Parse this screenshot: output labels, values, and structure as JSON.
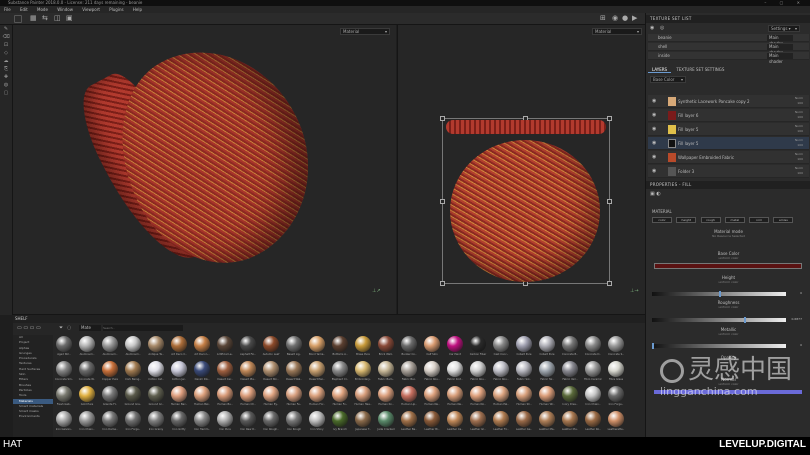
{
  "window": {
    "title": "Substance Painter 2018.0.0 - License: 211 days remaining - beanie"
  },
  "menu": [
    "File",
    "Edit",
    "Mode",
    "Window",
    "Viewport",
    "Plugins",
    "Help"
  ],
  "viewport": {
    "view3d_mode": "Material",
    "view2d_mode": "Material"
  },
  "texture_set_list": {
    "title": "TEXTURE SET LIST",
    "settings_label": "Settings ▾",
    "rows": [
      {
        "name": "beanie",
        "shader": "Main shader"
      },
      {
        "name": "shell",
        "shader": "Main shader"
      },
      {
        "name": "inside",
        "shader": "Main shader"
      }
    ]
  },
  "layers_panel": {
    "tabs": [
      "LAYERS",
      "TEXTURE SET SETTINGS"
    ],
    "blend_dropdown": "Base Color",
    "rows": [
      {
        "name": "Synthetic Lacework Pancake copy 2",
        "thumb": "#d7a978",
        "selected": false,
        "blend": "Norm",
        "opacity": "100"
      },
      {
        "name": "Fill layer 6",
        "thumb": "#7a1b1b",
        "selected": false,
        "blend": "Norm",
        "opacity": "100"
      },
      {
        "name": "Fill layer 5",
        "thumb": "#e0c04a",
        "selected": false,
        "blend": "Norm",
        "opacity": "100"
      },
      {
        "name": "Fill layer 5",
        "thumb": "#111111",
        "selected": true,
        "blend": "Norm",
        "opacity": "100"
      },
      {
        "name": "Wallpaper Embroided Fabric",
        "thumb": "#b84a2a",
        "selected": false,
        "blend": "Norm",
        "opacity": "100"
      },
      {
        "name": "Folder 3",
        "thumb": "#555555",
        "selected": false,
        "blend": "Norm",
        "opacity": "100"
      }
    ]
  },
  "properties": {
    "title": "PROPERTIES - FILL",
    "section": "MATERIAL",
    "channels": [
      "color",
      "height",
      "rough",
      "metal",
      "nrm",
      "emiss"
    ],
    "material_mode": {
      "label": "Material mode",
      "value": "No Resource Selected"
    },
    "base_color": {
      "label": "Base Color",
      "sub": "uniform color",
      "swatch": "#5a1212"
    },
    "height": {
      "label": "Height",
      "sub": "uniform color",
      "value": "0",
      "fill": 0.5
    },
    "roughness": {
      "label": "Roughness",
      "sub": "uniform color",
      "value": "0.6877",
      "fill": 0.69
    },
    "metallic": {
      "label": "Metallic",
      "sub": "uniform color",
      "value": "0",
      "fill": 0.0
    },
    "opacity_label": "Opacity",
    "normal_label": "Normal",
    "normal_sub": "uniform color"
  },
  "shelf": {
    "title": "SHELF",
    "search_placeholder": "Search...",
    "filter_label": "Mate",
    "categories": [
      "All",
      "Project",
      "Alphas",
      "Grunges",
      "Procedurals",
      "Textures",
      "Hard Surfaces",
      "Skin",
      "Filters",
      "Brushes",
      "Particles",
      "Tools",
      "Materials",
      "Smart materials",
      "Smart masks",
      "Environments"
    ],
    "active_category": "Materials",
    "materials": [
      {
        "n": "Aged Stri..",
        "c": "#6b6b6b"
      },
      {
        "n": "Aluminum..",
        "c": "#b5b5b5"
      },
      {
        "n": "Aluminum..",
        "c": "#9a9a9a"
      },
      {
        "n": "Aluminum..",
        "c": "#c8c8c8"
      },
      {
        "n": "Antique Ta..",
        "c": "#a88a6a"
      },
      {
        "n": "Art Deco C..",
        "c": "#ad6e3a"
      },
      {
        "n": "Art Deco L..",
        "c": "#c57f46"
      },
      {
        "n": "Artificial Le..",
        "c": "#5a4638"
      },
      {
        "n": "Asphalt Fin..",
        "c": "#4a4a4a"
      },
      {
        "n": "Autumn Leaf",
        "c": "#8c4a2a"
      },
      {
        "n": "Basalt Lig..",
        "c": "#707070"
      },
      {
        "n": "Bond Yama..",
        "c": "#d8a068"
      },
      {
        "n": "Bottoms A..",
        "c": "#5c4030"
      },
      {
        "n": "Brass Pure",
        "c": "#c89a3a"
      },
      {
        "n": "Brick Wall..",
        "c": "#8a4a38"
      },
      {
        "n": "Bunker Co..",
        "c": "#6a6a6a"
      },
      {
        "n": "Calf Skin",
        "c": "#d89a70"
      },
      {
        "n": "Car Paint",
        "c": "#c01080"
      },
      {
        "n": "Carbon Fiber",
        "c": "#2a2a2a"
      },
      {
        "n": "Cast Conc..",
        "c": "#888888"
      },
      {
        "n": "Cobalt Pure",
        "c": "#a0a0b0"
      },
      {
        "n": "Cobalt Pure",
        "c": "#b0b0b8"
      },
      {
        "n": "Concrete B..",
        "c": "#777777"
      },
      {
        "n": "Concrete D..",
        "c": "#8a8a8a"
      },
      {
        "n": "Concrete S..",
        "c": "#9a9a9a"
      },
      {
        "n": "Concrete Sm..",
        "c": "#858585"
      },
      {
        "n": "Concrete W..",
        "c": "#6a6a6a"
      },
      {
        "n": "Copper Pure",
        "c": "#c8703a"
      },
      {
        "n": "Cork Being..",
        "c": "#a07a50"
      },
      {
        "n": "Cotton Cat..",
        "c": "#e0e0e8"
      },
      {
        "n": "Cotton Jer..",
        "c": "#c8c8d8"
      },
      {
        "n": "Denim Riv..",
        "c": "#3a4a78"
      },
      {
        "n": "Desert Cer..",
        "c": "#a06040"
      },
      {
        "n": "Desert Pla..",
        "c": "#c08858"
      },
      {
        "n": "Desert Stn..",
        "c": "#b09070"
      },
      {
        "n": "Desert Wal..",
        "c": "#9a7858"
      },
      {
        "n": "Desert Pan..",
        "c": "#c8a070"
      },
      {
        "n": "Elephant Cr..",
        "c": "#8a8a8a"
      },
      {
        "n": "Embroidery..",
        "c": "#d8b870"
      },
      {
        "n": "Fabric Bam..",
        "c": "#c8b898"
      },
      {
        "n": "Fabric Bar..",
        "c": "#a8a098"
      },
      {
        "n": "Fabric Rou..",
        "c": "#d8d0c8"
      },
      {
        "n": "Fabric Knit..",
        "c": "#e0e0e0"
      },
      {
        "n": "Fabric Rou..",
        "c": "#d0d0d0"
      },
      {
        "n": "Fabric Rou..",
        "c": "#c0c0c8"
      },
      {
        "n": "Fabric Sol..",
        "c": "#b8b8c0"
      },
      {
        "n": "Fabric Tw..",
        "c": "#a0a8b0"
      },
      {
        "n": "Fabric Vari..",
        "c": "#888890"
      },
      {
        "n": "Fibro Ceramic",
        "c": "#9a9a9a"
      },
      {
        "n": "Fibre Glass",
        "c": "#d8d8d0"
      },
      {
        "n": "Fresh Gab..",
        "c": "#7a7a70"
      },
      {
        "n": "Gold Pure",
        "c": "#e0b040"
      },
      {
        "n": "Granite Fl..",
        "c": "#7a7a7a"
      },
      {
        "n": "Ground Gra..",
        "c": "#5a5a4a"
      },
      {
        "n": "Ground Gr..",
        "c": "#606050"
      },
      {
        "n": "Human Bac..",
        "c": "#e0a080"
      },
      {
        "n": "Human Bel..",
        "c": "#dca07c"
      },
      {
        "n": "Human Bu..",
        "c": "#d89a78"
      },
      {
        "n": "Human Ch..",
        "c": "#dc9e7c"
      },
      {
        "n": "Human Ey..",
        "c": "#e0a482"
      },
      {
        "n": "Human Fe..",
        "c": "#d8a080"
      },
      {
        "n": "Human For..",
        "c": "#dca27e"
      },
      {
        "n": "Human Fo..",
        "c": "#e0a480"
      },
      {
        "n": "Human Hea..",
        "c": "#d89e7c"
      },
      {
        "n": "Human Kn..",
        "c": "#dca07e"
      },
      {
        "n": "Human Lip..",
        "c": "#c87060"
      },
      {
        "n": "Human Ne..",
        "c": "#dca07c"
      },
      {
        "n": "Human Ne..",
        "c": "#d89e7a"
      },
      {
        "n": "Human No..",
        "c": "#e0a27e"
      },
      {
        "n": "Human Pal..",
        "c": "#dca480"
      },
      {
        "n": "Human Sh..",
        "c": "#d8a07c"
      },
      {
        "n": "Human Wr..",
        "c": "#dc9e7a"
      },
      {
        "n": "Ivory Dres..",
        "c": "#5a6a3a"
      },
      {
        "n": "Iron Chain..",
        "c": "#c8c8c8"
      },
      {
        "n": "Iron Forge..",
        "c": "#6a6a6a"
      },
      {
        "n": "Iron Galvan..",
        "c": "#a8a8a8"
      },
      {
        "n": "Iron Chain..",
        "c": "#9a9a9a"
      },
      {
        "n": "Iron Dama..",
        "c": "#787878"
      },
      {
        "n": "Iron Forge..",
        "c": "#707070"
      },
      {
        "n": "Iron Grainy",
        "c": "#808080"
      },
      {
        "n": "Iron Gritty",
        "c": "#686868"
      },
      {
        "n": "Iron Hamm..",
        "c": "#888888"
      },
      {
        "n": "Iron Pure",
        "c": "#b0b0b0"
      },
      {
        "n": "Iron Raw D..",
        "c": "#5a5a5a"
      },
      {
        "n": "Iron Rough..",
        "c": "#6a6a6a"
      },
      {
        "n": "Iron Rough",
        "c": "#787878"
      },
      {
        "n": "Iron Shiny",
        "c": "#c0c0c0"
      },
      {
        "n": "Ivy Branch",
        "c": "#4a6a2a"
      },
      {
        "n": "Japanese T..",
        "c": "#8a6a4a"
      },
      {
        "n": "Jade Cracked",
        "c": "#5a8a6a"
      },
      {
        "n": "Leather Ba..",
        "c": "#a07048"
      },
      {
        "n": "Leather Bi..",
        "c": "#8a5a38"
      },
      {
        "n": "Leather Ca..",
        "c": "#c08858"
      },
      {
        "n": "Leather Gl..",
        "c": "#a07050"
      },
      {
        "n": "Leather Fo..",
        "c": "#b07c50"
      },
      {
        "n": "Leather Ge..",
        "c": "#9a6a48"
      },
      {
        "n": "Leather Ma..",
        "c": "#b08058"
      },
      {
        "n": "Leather Mu..",
        "c": "#a87850"
      },
      {
        "n": "Leather Ro..",
        "c": "#9a6a44"
      },
      {
        "n": "Leatherette..",
        "c": "#d09068"
      }
    ]
  },
  "footer": {
    "left": "HAT",
    "right": "LEVELUP.DIGITAL"
  },
  "watermark": {
    "title": "灵感中国",
    "url": "lingganchina.com"
  }
}
